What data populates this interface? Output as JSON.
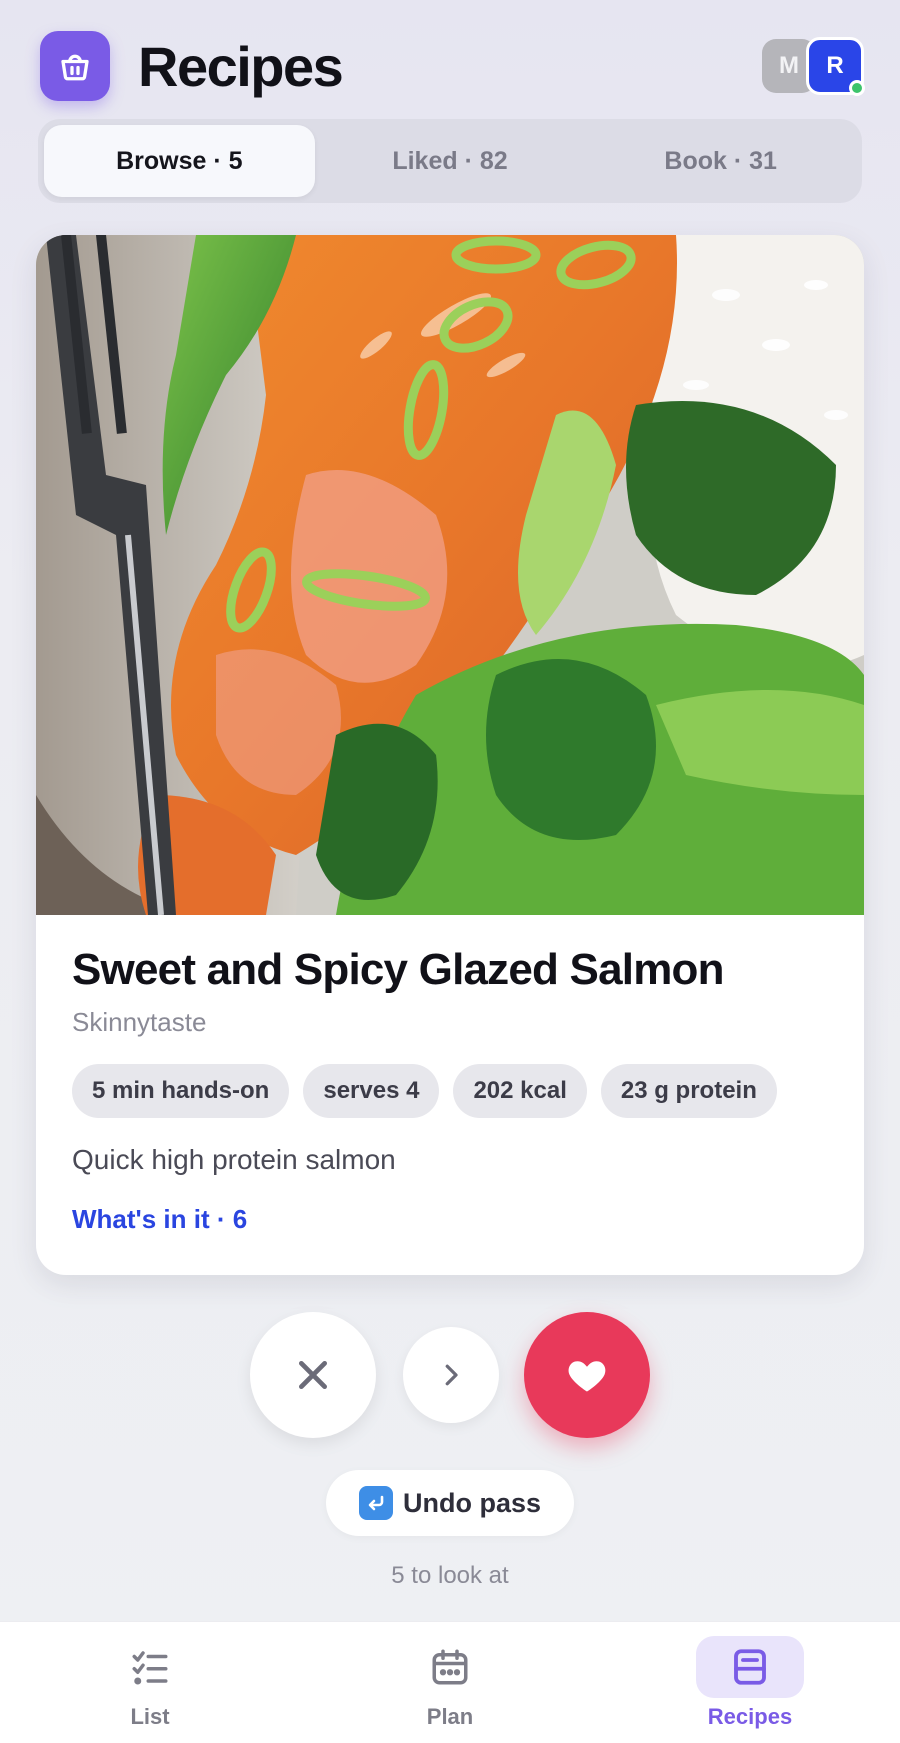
{
  "header": {
    "title": "Recipes",
    "logo_icon": "shopping-basket-icon",
    "avatars": [
      {
        "initial": "M",
        "color": "#b5b5ba"
      },
      {
        "initial": "R",
        "color": "#2a45e8",
        "online": true
      }
    ]
  },
  "tabs": [
    {
      "label": "Browse · 5",
      "active": true
    },
    {
      "label": "Liked · 82",
      "active": false
    },
    {
      "label": "Book · 31",
      "active": false
    }
  ],
  "recipe": {
    "title": "Sweet and Spicy Glazed Salmon",
    "source": "Skinnytaste",
    "chips": [
      "5 min hands-on",
      "serves 4",
      "202 kcal",
      "23 g protein"
    ],
    "description": "Quick high protein salmon",
    "ingredients_link": "What's in it · 6"
  },
  "actions": {
    "pass_icon": "close-icon",
    "next_icon": "chevron-right-icon",
    "like_icon": "heart-icon",
    "undo_label": "Undo pass",
    "remaining_text": "5 to look at"
  },
  "nav": [
    {
      "label": "List",
      "icon": "checklist-icon",
      "active": false
    },
    {
      "label": "Plan",
      "icon": "calendar-icon",
      "active": false
    },
    {
      "label": "Recipes",
      "icon": "recipe-book-icon",
      "active": true
    }
  ],
  "colors": {
    "accent": "#7a5be6",
    "like": "#e8395a",
    "link": "#2a45e0"
  }
}
